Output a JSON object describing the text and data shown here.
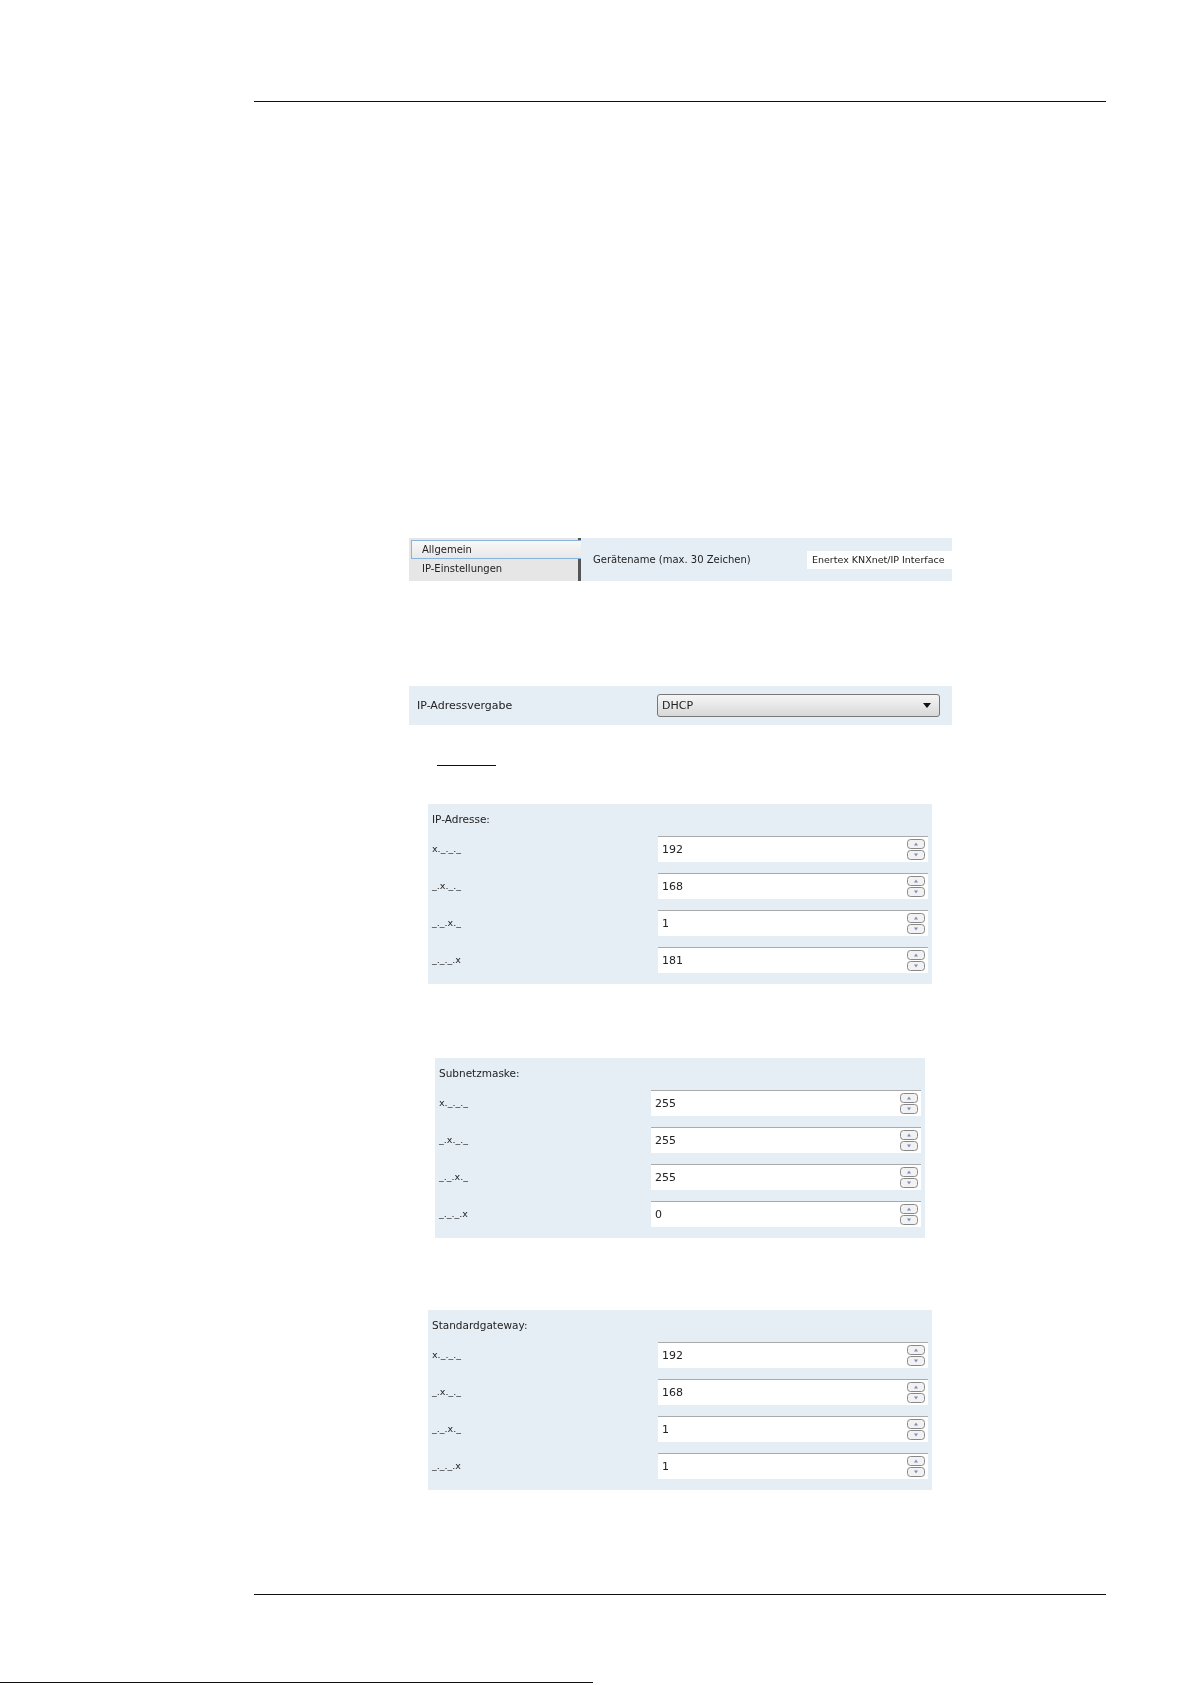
{
  "settings_nav": {
    "items": [
      {
        "label": "Allgemein",
        "selected": true
      },
      {
        "label": "IP-Einstellungen",
        "selected": false
      }
    ]
  },
  "device_name": {
    "label": "Gerätename (max. 30 Zeichen)",
    "value": "Enertex KNXnet/IP Interface"
  },
  "ip_assignment": {
    "label": "IP-Adressvergabe",
    "value": "DHCP"
  },
  "groups": [
    {
      "title": "IP-Adresse:",
      "rows": [
        {
          "label": "x._._._",
          "value": "192"
        },
        {
          "label": "_.x._._",
          "value": "168"
        },
        {
          "label": "_._.x._",
          "value": "1"
        },
        {
          "label": "_._._.x",
          "value": "181"
        }
      ]
    },
    {
      "title": "Subnetzmaske:",
      "rows": [
        {
          "label": "x._._._",
          "value": "255"
        },
        {
          "label": "_.x._._",
          "value": "255"
        },
        {
          "label": "_._.x._",
          "value": "255"
        },
        {
          "label": "_._._.x",
          "value": "0"
        }
      ]
    },
    {
      "title": "Standardgateway:",
      "rows": [
        {
          "label": "x._._._",
          "value": "192"
        },
        {
          "label": "_.x._._",
          "value": "168"
        },
        {
          "label": "_._.x._",
          "value": "1"
        },
        {
          "label": "_._._.x",
          "value": "1"
        }
      ]
    }
  ]
}
